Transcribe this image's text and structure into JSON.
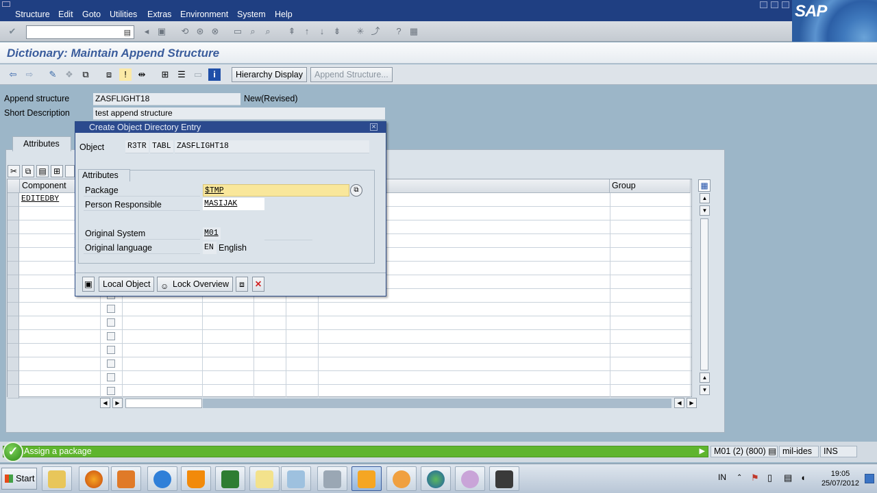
{
  "menubar": {
    "items": [
      "Structure",
      "Edit",
      "Goto",
      "Utilities",
      "Extras",
      "Environment",
      "System",
      "Help"
    ],
    "logo_text": "SAP"
  },
  "toolbar": {
    "command_field_value": ""
  },
  "title": "Dictionary: Maintain Append Structure",
  "app_toolbar": {
    "hierarchy_display": "Hierarchy Display",
    "append_structure": "Append Structure..."
  },
  "header": {
    "append_structure_label": "Append structure",
    "append_structure_value": "ZASFLIGHT18",
    "status": "New(Revised)",
    "short_description_label": "Short Description",
    "short_description_value": "test append structure"
  },
  "tab": {
    "label": "Attributes"
  },
  "grid": {
    "columns": [
      "Component",
      "Group"
    ],
    "rows": [
      "EDITEDBY",
      "",
      "",
      "",
      "",
      "",
      "",
      "",
      "",
      "",
      "",
      "",
      "",
      "",
      ""
    ]
  },
  "dialog": {
    "title": "Create Object Directory Entry",
    "object_label": "Object",
    "object_pgmid": "R3TR",
    "object_type": "TABL",
    "object_name": "ZASFLIGHT18",
    "group_title": "Attributes",
    "package_label": "Package",
    "package_value": "$TMP",
    "person_label": "Person Responsible",
    "person_value": "MASIJAK",
    "orig_system_label": "Original System",
    "orig_system_value": "M01",
    "orig_lang_label": "Original language",
    "orig_lang_code": "EN",
    "orig_lang_name": "English",
    "local_object_button": "Local Object",
    "lock_overview_button": "Lock Overview"
  },
  "statusbar": {
    "message": "Assign a package",
    "system": "M01 (2) (800)",
    "server": "mil-ides",
    "mode": "INS"
  },
  "taskbar": {
    "start": "Start",
    "language": "IN",
    "time": "19:05",
    "date": "25/07/2012"
  },
  "colors": {
    "menubar": "#1f3f82",
    "title_text": "#3a5c9c",
    "status_green": "#5fb52e",
    "input_highlight": "#f9e79b"
  }
}
